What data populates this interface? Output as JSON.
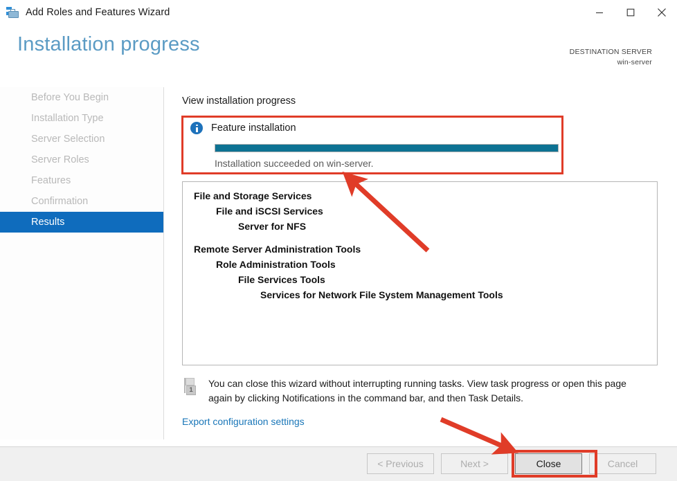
{
  "window": {
    "title": "Add Roles and Features Wizard",
    "app_icon": "toolbox-icon",
    "controls": {
      "minimize": "minimize-icon",
      "maximize": "maximize-icon",
      "close": "close-icon"
    }
  },
  "header": {
    "page_title": "Installation progress",
    "destination_label": "DESTINATION SERVER",
    "destination_value": "win-server",
    "title_color": "#5b9bc4"
  },
  "sidebar": {
    "items": [
      {
        "label": "Before You Begin",
        "selected": false
      },
      {
        "label": "Installation Type",
        "selected": false
      },
      {
        "label": "Server Selection",
        "selected": false
      },
      {
        "label": "Server Roles",
        "selected": false
      },
      {
        "label": "Features",
        "selected": false
      },
      {
        "label": "Confirmation",
        "selected": false
      },
      {
        "label": "Results",
        "selected": true
      }
    ],
    "selected_color": "#0f6cbd"
  },
  "content": {
    "view_progress_label": "View installation progress",
    "progress": {
      "icon": "info-icon",
      "title": "Feature installation",
      "percent": 100,
      "bar_color": "#0d7293",
      "status": "Installation succeeded on win-server."
    },
    "results": [
      {
        "text": "File and Storage Services",
        "level": 0,
        "gap_before": false
      },
      {
        "text": "File and iSCSI Services",
        "level": 1,
        "gap_before": false
      },
      {
        "text": "Server for NFS",
        "level": 2,
        "gap_before": false
      },
      {
        "text": "Remote Server Administration Tools",
        "level": 0,
        "gap_before": true
      },
      {
        "text": "Role Administration Tools",
        "level": 1,
        "gap_before": false
      },
      {
        "text": "File Services Tools",
        "level": 2,
        "gap_before": false
      },
      {
        "text": "Services for Network File System Management Tools",
        "level": 3,
        "gap_before": false
      }
    ],
    "note": {
      "icon": "notification-flag-icon",
      "badge_count": "1",
      "text": "You can close this wizard without interrupting running tasks. View task progress or open this page again by clicking Notifications in the command bar, and then Task Details."
    },
    "export_link": "Export configuration settings"
  },
  "footer": {
    "buttons": [
      {
        "label": "< Previous",
        "enabled": false
      },
      {
        "label": "Next >",
        "enabled": false
      },
      {
        "label": "Close",
        "enabled": true
      },
      {
        "label": "Cancel",
        "enabled": false
      }
    ]
  },
  "annotations": {
    "color": "#e03c28",
    "boxes": [
      "progress-panel-highlight",
      "close-button-highlight"
    ],
    "arrows": [
      "arrow-to-progress-panel",
      "arrow-to-close-button"
    ]
  }
}
